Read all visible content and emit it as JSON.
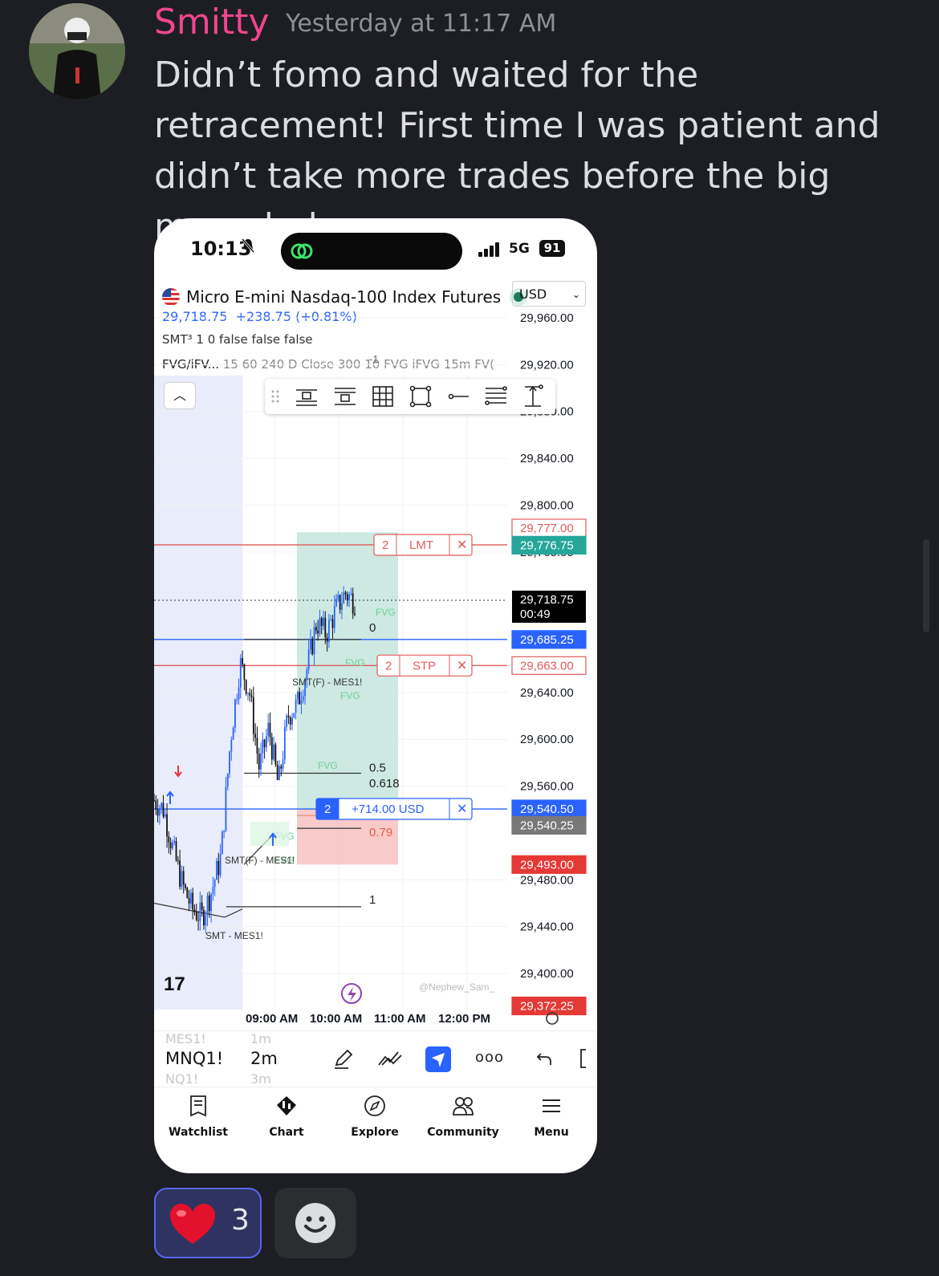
{
  "message": {
    "username": "Smitty",
    "timestamp": "Yesterday at 11:17 AM",
    "text": "Didn’t fomo and waited for the retracement! First time I was patient and didn’t take more trades before the big move haha"
  },
  "status_bar": {
    "time": "10:13",
    "signal": "5G",
    "battery": "91"
  },
  "instrument": {
    "name": "Micro E-mini Nasdaq-100 Index Futures",
    "currency": "USD",
    "last_price": "29,718.75",
    "change": "+238.75 (+0.81%)"
  },
  "indicators": {
    "smt": "SMT³ 1 0 false false false",
    "fvg_name": "FVG/iFV...",
    "fvg_params": " 15 60 240 D Close 300 10 FVG iFVG 15m FV("
  },
  "price_axis": {
    "ticks": [
      "29,960.00",
      "29,920.00",
      "29,880.00",
      "29,840.00",
      "29,800.00",
      "29,760.00",
      "29,640.00",
      "29,600.00",
      "29,560.00",
      "29,480.00",
      "29,440.00",
      "29,400.00"
    ],
    "badges": {
      "limit_price": "29,777.00",
      "ask": "29,776.75",
      "last": "29,718.75",
      "countdown": "00:49",
      "position": "29,685.25",
      "stop_price": "29,663.00",
      "entry": "29,540.50",
      "bid": "29,540.25",
      "low_marker": "29,493.00",
      "bottom": "29,372.25"
    }
  },
  "orders": {
    "limit": {
      "qty": "2",
      "label": "LMT"
    },
    "stop": {
      "qty": "2",
      "label": "STP"
    },
    "position": {
      "qty": "2",
      "pnl": "+714.00 USD"
    }
  },
  "fib_levels": [
    "0",
    "0.5",
    "0.618",
    "0.79",
    "1"
  ],
  "annotations": {
    "fvg": "FVG",
    "smt_mes_f": "SMT(F) - MES1!",
    "smt_mes": "SMT - MES1!",
    "watermark": "@Nephew_Sam_",
    "superscript": "-1"
  },
  "time_axis": [
    "09:00 AM",
    "10:00 AM",
    "11:00 AM",
    "12:00 PM"
  ],
  "symbol_bar": {
    "symbol_prev": "MES1!",
    "symbol": "MNQ1!",
    "symbol_next": "NQ1!",
    "tf_prev": "1m",
    "timeframe": "2m",
    "tf_next": "3m"
  },
  "nav": [
    "Watchlist",
    "Chart",
    "Explore",
    "Community",
    "Menu"
  ],
  "reactions": {
    "heart_count": "3"
  },
  "colors": {
    "accent_username": "#f0468e",
    "tv_blue": "#2962ff",
    "order_red": "#e05b5b",
    "profit_green": "#26a69a",
    "loss_red": "#f7b4b4",
    "session_blue": "#e8ecfb"
  },
  "chart_data": {
    "type": "candlestick",
    "ylim": [
      29360,
      29980
    ],
    "x": [
      "08:28",
      "08:40",
      "08:52",
      "09:04",
      "09:16",
      "09:28",
      "09:40",
      "09:52",
      "10:04",
      "10:16",
      "10:28",
      "10:40",
      "10:52",
      "11:04",
      "11:16",
      "11:28",
      "11:40",
      "11:52",
      "12:04",
      "12:16",
      "12:28",
      "12:40"
    ],
    "approx_close": [
      29548,
      29540,
      29505,
      29475,
      29455,
      29448,
      29470,
      29500,
      29600,
      29665,
      29640,
      29575,
      29610,
      29560,
      29620,
      29630,
      29660,
      29700,
      29690,
      29710,
      29725,
      29718
    ]
  }
}
